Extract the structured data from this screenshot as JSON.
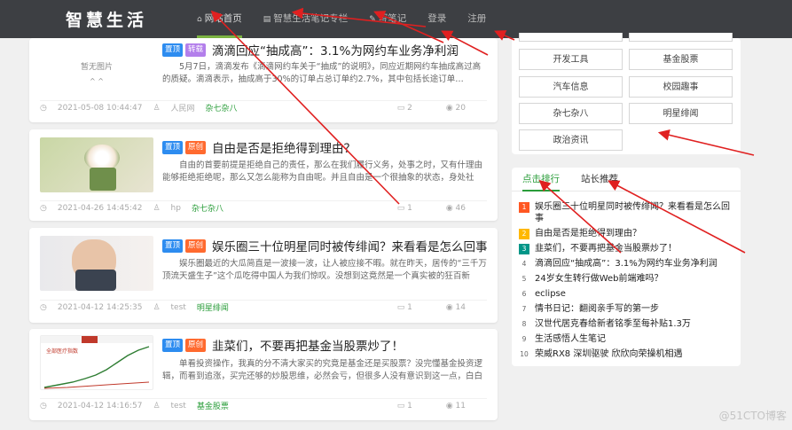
{
  "brand": "智慧生活",
  "nav": [
    {
      "icon": "⌂",
      "label": "网站首页"
    },
    {
      "icon": "▤",
      "label": "智慧生活笔记专栏"
    },
    {
      "icon": "✎",
      "label": "写笔记"
    },
    {
      "icon": "",
      "label": "登录"
    },
    {
      "icon": "",
      "label": "注册"
    }
  ],
  "articles": [
    {
      "tags": [
        "置顶",
        "转载"
      ],
      "title": "滴滴回应“抽成高”：3.1%为网约车业务净利润",
      "excerpt": "5月7日，滴滴发布《滴滴网约车关于“抽成”的说明》，同应近期网约车抽成高过高的质疑。滴滴表示，抽成高于30%的订单占总订单约2.7%，其中包括长途订单…",
      "date": "2021-05-08 10:44:47",
      "author": "人民网",
      "category": "杂七杂八",
      "comments": "2",
      "views": "20",
      "thumb_text": "暂无图片"
    },
    {
      "tags": [
        "置顶",
        "原创"
      ],
      "title": "自由是否是拒绝得到理由？",
      "excerpt": "自由的首要前提是拒绝自己的责任，那么在我们履行义务，处事之时，又有什理由能够拒绝拒绝呢，那么又怎么能称为自由呢。并且自由是一个很抽象的状态，身处社会，不免会存在与自己有关",
      "date": "2021-04-26 14:45:42",
      "author": "hp",
      "category": "杂七杂八",
      "comments": "1",
      "views": "46",
      "thumb_text": ""
    },
    {
      "tags": [
        "置顶",
        "原创"
      ],
      "title": "娱乐圈三十位明星同时被传绯闻？来看看是怎么回事",
      "excerpt": "娱乐圈最近的大瓜简直是一波接一波，让人被应接不暇。就在昨天，居传的“三千万顶流天盛生子”这个瓜吃得中国人为我们惊叹。没想到这竟然是一个真实被的狂百新",
      "date": "2021-04-12 14:25:35",
      "author": "test",
      "category": "明星绯闻",
      "comments": "1",
      "views": "14",
      "thumb_text": ""
    },
    {
      "tags": [
        "置顶",
        "原创"
      ],
      "title": "韭菜们，不要再把基金当股票炒了！",
      "excerpt": "单看投资操作，我真的分不清大家买的究竟是基金还是买股票？没完懂基金投资逻辑，而看到追涨，买完还够的炒股思维，必然会亏，但很多人没有意识到这一点，白白浪费基金的优势",
      "date": "2021-04-12 14:16:57",
      "author": "test",
      "category": "基金股票",
      "comments": "1",
      "views": "11",
      "thumb_text": "全部医疗指数"
    }
  ],
  "categories": [
    "开发工具",
    "基金股票",
    "汽车信息",
    "校园趣事",
    "杂七杂八",
    "明星绯闻",
    "政治资讯"
  ],
  "tabs": [
    "点击排行",
    "站长推荐"
  ],
  "ranking": [
    {
      "num": "1",
      "title": "娱乐圈三十位明星同时被传绯闻？来看看是怎么回事"
    },
    {
      "num": "2",
      "title": "自由是否是拒绝得到理由？"
    },
    {
      "num": "3",
      "title": "韭菜们，不要再把基金当股票炒了！"
    },
    {
      "num": "4",
      "title": "滴滴回应“抽成高”：3.1%为网约车业务净利润"
    },
    {
      "num": "5",
      "title": "24岁女生转行做Web前端难吗？"
    },
    {
      "num": "6",
      "title": "eclipse"
    },
    {
      "num": "7",
      "title": "情书日记：翻阅亲手写的第一步"
    },
    {
      "num": "8",
      "title": "汉世代居克春给新者铭季至每补贴1.3万"
    },
    {
      "num": "9",
      "title": "生活感悟人生笔记"
    },
    {
      "num": "10",
      "title": "荣威RX8 深圳驱驶 欣欣向荣操机相遇"
    }
  ],
  "rank_colors": [
    "#ff5722",
    "#ffb800",
    "#009688"
  ],
  "watermark": "@51CTO博客"
}
